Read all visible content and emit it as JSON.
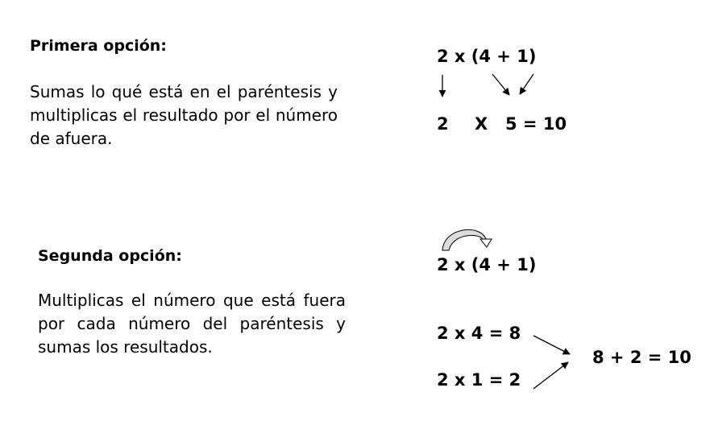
{
  "option1": {
    "heading": "Primera opción:",
    "text": "Sumas lo qué está en el paréntesis y multiplicas el resultado por el número de afuera.",
    "expr": "2 x (4 + 1)",
    "left": "2",
    "times": "X",
    "right": "5 = 10"
  },
  "option2": {
    "heading": "Segunda opción:",
    "text": "Multiplicas el número que está fuera por cada número del paréntesis y sumas los resultados.",
    "expr": "2 x (4 + 1)",
    "step1": "2 x 4 = 8",
    "step2": "2 x 1 = 2",
    "result": "8 + 2 = 10"
  }
}
